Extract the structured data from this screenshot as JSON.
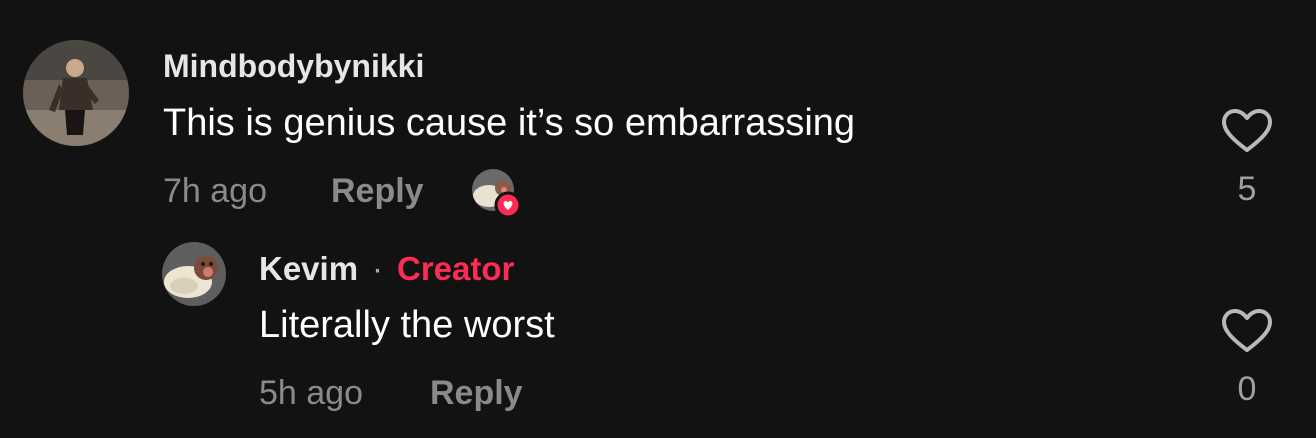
{
  "comments": [
    {
      "username": "Mindbodybynikki",
      "text": "This is genius cause it’s so embarrassing",
      "time": "7h ago",
      "reply_label": "Reply",
      "like_count": "5",
      "liked_by_creator": true
    }
  ],
  "reply": {
    "username": "Kevim",
    "separator": "·",
    "badge": "Creator",
    "text": "Literally the worst",
    "time": "5h ago",
    "reply_label": "Reply",
    "like_count": "0"
  },
  "colors": {
    "background": "#121212",
    "creator_badge": "#fe2c55",
    "muted_text": "#8a8a8a"
  },
  "icons": {
    "like": "heart-outline-icon",
    "creator_like": "creator-heart-badge-icon"
  }
}
